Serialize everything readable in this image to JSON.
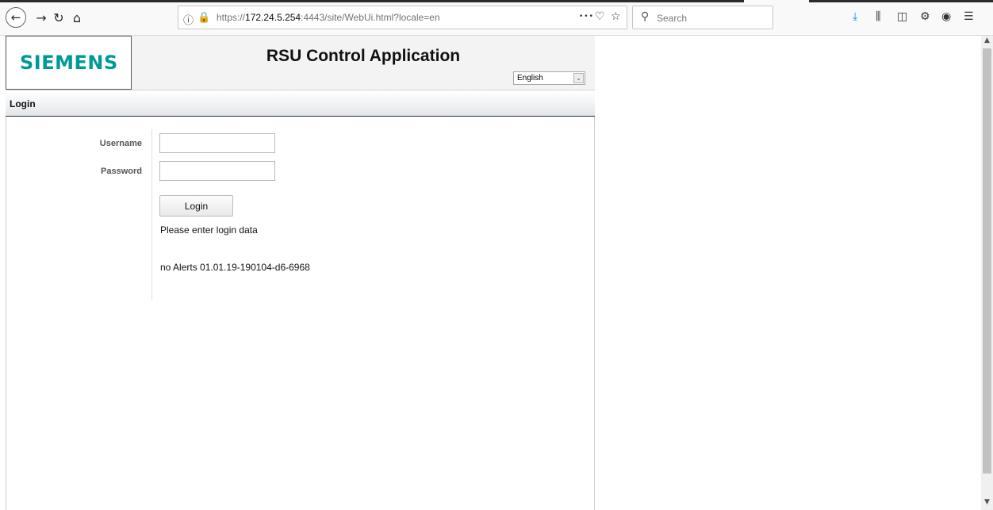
{
  "browser": {
    "url_prefix": "https://",
    "url_host": "172.24.5.254",
    "url_rest": ":4443/site/WebUi.html?locale=en",
    "search_placeholder": "Search",
    "more_glyph": "•••"
  },
  "header": {
    "logo_text": "SIEMENS",
    "title": "RSU Control Application",
    "language_selected": "English"
  },
  "section": {
    "title": "Login"
  },
  "form": {
    "username_label": "Username",
    "password_label": "Password",
    "username_value": "",
    "password_value": "",
    "login_button": "Login",
    "status_message": "Please enter login data",
    "alerts_version": "no Alerts 01.01.19-190104-d6-6968"
  },
  "colors": {
    "brand": "#009999",
    "download_icon": "#0a84ff"
  }
}
